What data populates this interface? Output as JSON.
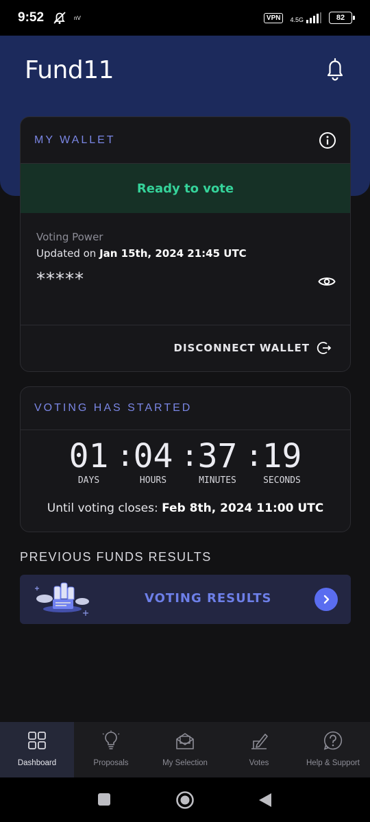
{
  "status_bar": {
    "time": "9:52",
    "small_label": "nV",
    "vpn": "VPN",
    "network": "4.5G",
    "battery": "82"
  },
  "header": {
    "app_title": "Fund11"
  },
  "wallet": {
    "title": "MY WALLET",
    "status": "Ready to vote",
    "status_color": "#35d39a",
    "voting_power_label": "Voting Power",
    "updated_prefix": "Updated on ",
    "updated_date": "Jan 15th, 2024 21:45 UTC",
    "voting_power_value": "*****",
    "disconnect_label": "DISCONNECT WALLET"
  },
  "voting": {
    "title": "VOTING HAS STARTED",
    "countdown": [
      {
        "value": "01",
        "label": "DAYS"
      },
      {
        "value": "04",
        "label": "HOURS"
      },
      {
        "value": "37",
        "label": "MINUTES"
      },
      {
        "value": "19",
        "label": "SECONDS"
      }
    ],
    "closes_prefix": "Until voting closes: ",
    "closes_date": "Feb 8th, 2024 11:00 UTC"
  },
  "previous_results": {
    "title": "PREVIOUS FUNDS RESULTS",
    "banner_label": "VOTING RESULTS"
  },
  "bottom_nav": [
    {
      "label": "Dashboard",
      "icon": "grid-icon",
      "active": true
    },
    {
      "label": "Proposals",
      "icon": "lightbulb-icon",
      "active": false
    },
    {
      "label": "My Selection",
      "icon": "envelope-icon",
      "active": false
    },
    {
      "label": "Votes",
      "icon": "ballot-pen-icon",
      "active": false
    },
    {
      "label": "Help & Support",
      "icon": "question-icon",
      "active": false
    }
  ],
  "colors": {
    "header_bg": "#1c2a5c",
    "accent": "#7a86e4",
    "results_arrow": "#5a6df0"
  }
}
